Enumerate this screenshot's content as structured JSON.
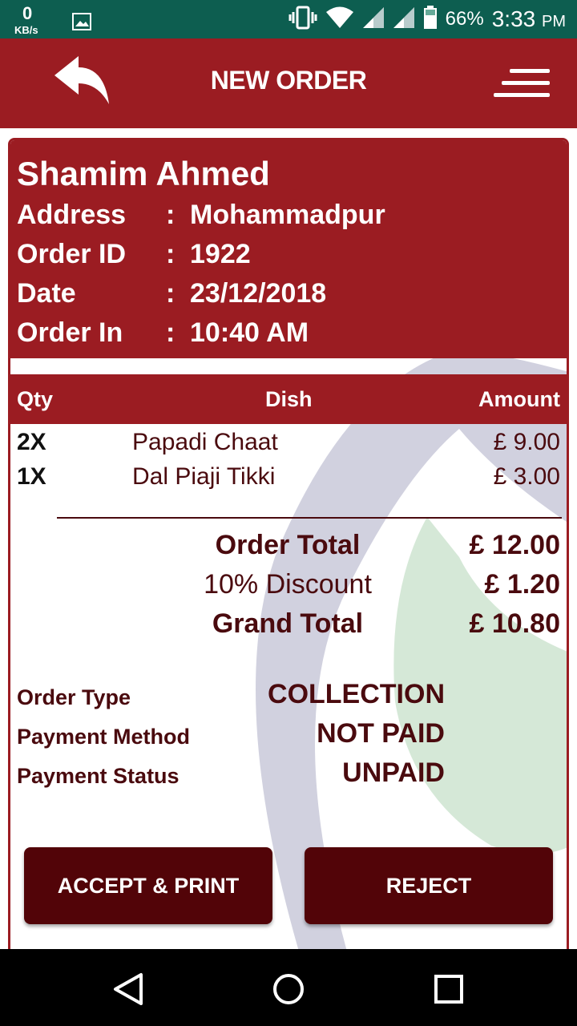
{
  "status_bar": {
    "net_speed_value": "0",
    "net_speed_unit": "KB/s",
    "battery_percent": "66%",
    "time": "3:33",
    "time_suffix": "PM",
    "icons": [
      "gallery-icon",
      "vibrate-icon",
      "wifi-icon",
      "signal-icon",
      "signal-icon",
      "battery-icon"
    ],
    "color": "#0d5e50"
  },
  "app_bar": {
    "title": "NEW ORDER",
    "back_icon": "back-arrow-icon",
    "menu_icon": "menu-icon",
    "color": "#9b1c22"
  },
  "customer": {
    "name": "Shamim Ahmed",
    "fields": [
      {
        "label": "Address",
        "colon": ":",
        "value": "Mohammadpur"
      },
      {
        "label": "Order ID",
        "colon": ":",
        "value": "1922"
      },
      {
        "label": "Date",
        "colon": ":",
        "value": "23/12/2018"
      },
      {
        "label": "Order In",
        "colon": ":",
        "value": "10:40 AM"
      }
    ]
  },
  "table": {
    "headers": {
      "qty": "Qty",
      "dish": "Dish",
      "amount": "Amount"
    },
    "items": [
      {
        "qty": "2X",
        "dish": "Papadi Chaat",
        "amount": "£ 9.00"
      },
      {
        "qty": "1X",
        "dish": "Dal Piaji Tikki",
        "amount": "£ 3.00"
      }
    ]
  },
  "totals": {
    "order_total_label": "Order Total",
    "order_total_value": "£ 12.00",
    "discount_label": "10% Discount",
    "discount_value": "£ 1.20",
    "grand_total_label": "Grand Total",
    "grand_total_value": "£ 10.80"
  },
  "order_meta": [
    {
      "label": "Order Type",
      "value": "COLLECTION"
    },
    {
      "label": "Payment Method",
      "value": "NOT PAID"
    },
    {
      "label": "Payment Status",
      "value": "UNPAID"
    }
  ],
  "actions": {
    "accept_label": "ACCEPT & PRINT",
    "reject_label": "REJECT",
    "button_color": "#520408"
  },
  "nav_bar": {
    "icons": [
      "back-triangle-icon",
      "home-circle-icon",
      "recents-square-icon"
    ]
  }
}
